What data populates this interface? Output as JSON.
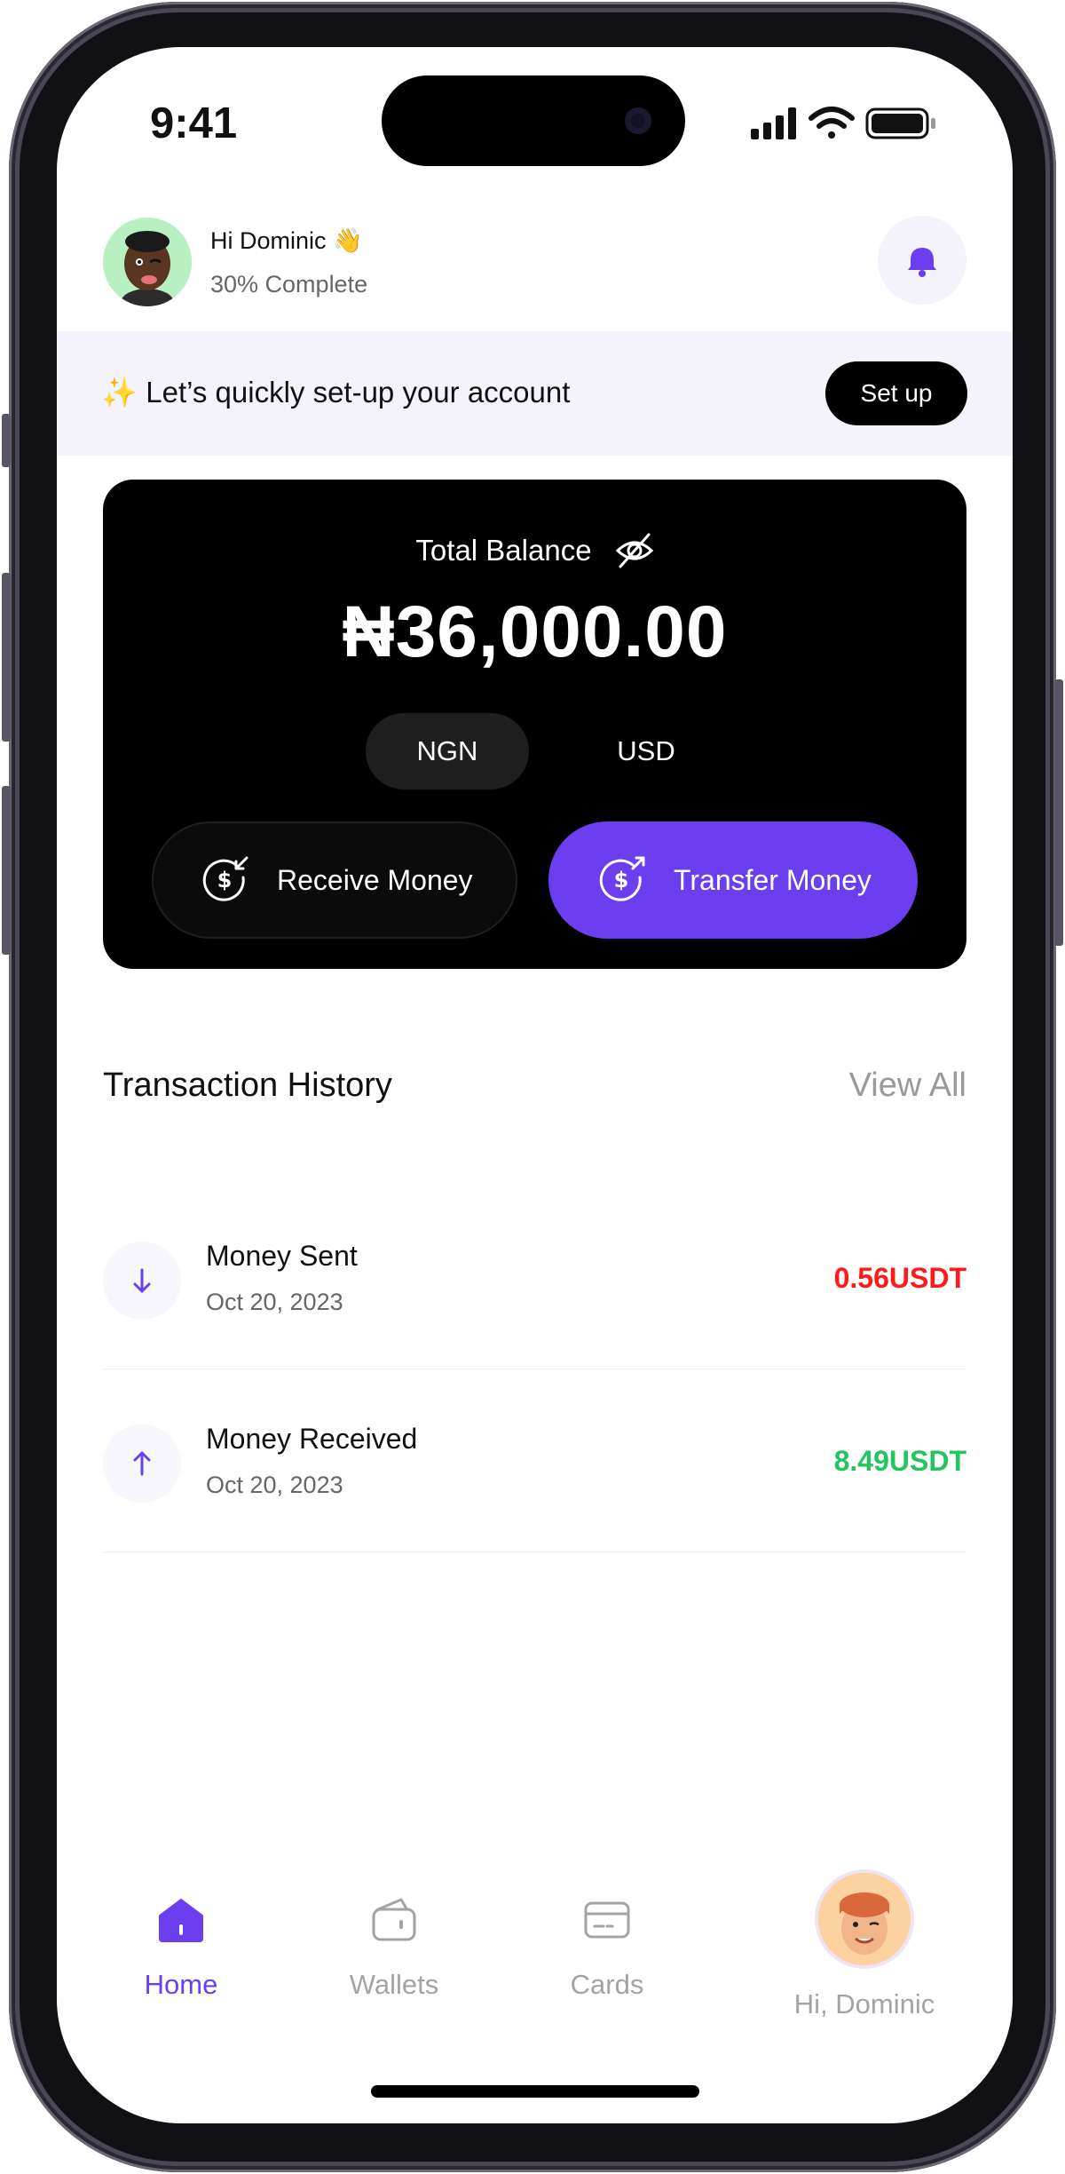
{
  "status_bar": {
    "time": "9:41"
  },
  "header": {
    "greeting": "Hi Dominic 👋",
    "progress": "30% Complete"
  },
  "banner": {
    "text": "✨ Let’s quickly set-up your account",
    "button": "Set up"
  },
  "balance_card": {
    "label": "Total Balance",
    "amount": "₦36,000.00",
    "currencies": [
      "NGN",
      "USD"
    ],
    "selected_currency": "NGN",
    "receive_label": "Receive Money",
    "transfer_label": "Transfer Money"
  },
  "transactions": {
    "title": "Transaction History",
    "view_all": "View All",
    "items": [
      {
        "name": "Money Sent",
        "date": "Oct 20, 2023",
        "amount": "0.56USDT",
        "direction": "sent",
        "color": "#ff1a1a"
      },
      {
        "name": "Money Received",
        "date": "Oct 20, 2023",
        "amount": "8.49USDT",
        "direction": "received",
        "color": "#22c55e"
      }
    ]
  },
  "nav": {
    "items": [
      {
        "label": "Home",
        "active": true
      },
      {
        "label": "Wallets",
        "active": false
      },
      {
        "label": "Cards",
        "active": false
      },
      {
        "label": "Hi, Dominic",
        "active": false
      }
    ]
  },
  "colors": {
    "accent": "#6b3ff0",
    "banner_bg": "#f4f2fb",
    "card_bg": "#000000",
    "inactive_nav": "#a3a3a3"
  }
}
